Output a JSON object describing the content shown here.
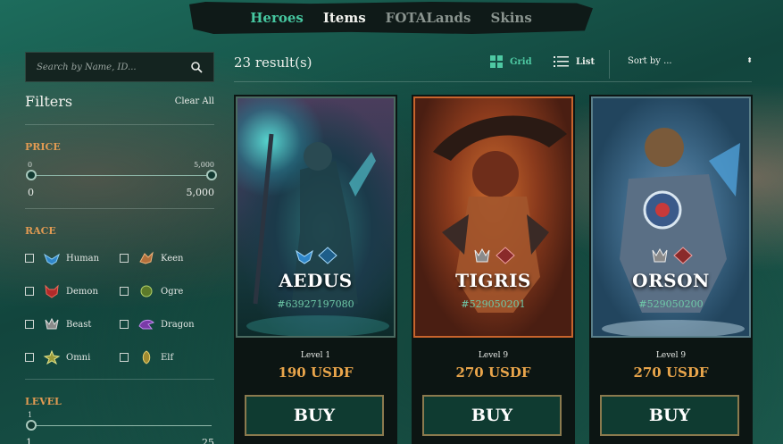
{
  "nav": {
    "tabs": [
      "Heroes",
      "Items",
      "FOTALands",
      "Skins"
    ]
  },
  "search": {
    "placeholder": "Search by Name, ID..."
  },
  "filters": {
    "title": "Filters",
    "clear_label": "Clear All",
    "price": {
      "title": "PRICE",
      "min_tick": "0",
      "max_tick": "5,000",
      "min": "0",
      "max": "5,000"
    },
    "race": {
      "title": "RACE",
      "items": [
        "Human",
        "Keen",
        "Demon",
        "Ogre",
        "Beast",
        "Dragon",
        "Omni",
        "Elf"
      ]
    },
    "level": {
      "title": "LEVEL",
      "tick": "1",
      "min": "1",
      "max": "25"
    }
  },
  "results": {
    "count_text": "23 result(s)"
  },
  "view": {
    "grid_label": "Grid",
    "list_label": "List"
  },
  "sort": {
    "label": "Sort by ...",
    "arrow": "⬍"
  },
  "colors": {
    "accent": "#46c7a0",
    "price": "#e9a54b",
    "section": "#e09a52"
  },
  "cards": [
    {
      "name": "AEDUS",
      "id": "#63927197080",
      "level": "Level  1",
      "price": "190 USDF",
      "buy": "BUY"
    },
    {
      "name": "TIGRIS",
      "id": "#529050201",
      "level": "Level  9",
      "price": "270 USDF",
      "buy": "BUY"
    },
    {
      "name": "ORSON",
      "id": "#529050200",
      "level": "Level  9",
      "price": "270 USDF",
      "buy": "BUY"
    }
  ]
}
